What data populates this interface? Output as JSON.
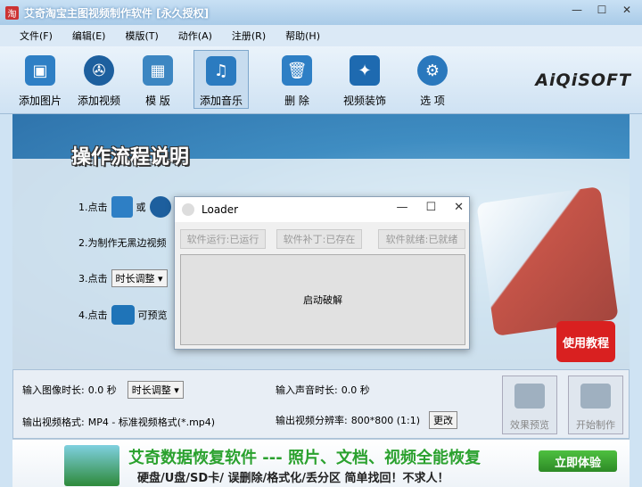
{
  "window": {
    "title": "艾奇淘宝主图视频制作软件 [永久授权]",
    "app_icon": "淘",
    "min": "—",
    "max": "☐",
    "close": "✕"
  },
  "menu": [
    "文件(F)",
    "编辑(E)",
    "模版(T)",
    "动作(A)",
    "注册(R)",
    "帮助(H)"
  ],
  "toolbar": [
    {
      "label": "添加图片",
      "icon": "add-image-icon"
    },
    {
      "label": "添加视频",
      "icon": "add-video-icon"
    },
    {
      "label": "模 版",
      "icon": "template-icon"
    },
    {
      "label": "添加音乐",
      "icon": "music-note-icon",
      "active": true
    },
    {
      "label": "删 除",
      "icon": "trash-icon"
    },
    {
      "label": "视频装饰",
      "icon": "decoration-icon"
    },
    {
      "label": "选 项",
      "icon": "gear-icon"
    }
  ],
  "brand": "AiQiSOFT",
  "main": {
    "heading": "操作流程说明",
    "step1_prefix": "1.点击",
    "step1_or": "或",
    "step2": "2.为制作无黑边视频",
    "step3_prefix": "3.点击",
    "step3_btn": "时长调整 ▾",
    "step4_prefix": "4.点击",
    "step4_text": "可预览",
    "tutorial": "使用教程"
  },
  "settings": {
    "image_duration_label": "输入图像时长:",
    "image_duration_value": "0.0 秒",
    "duration_adjust": "时长调整 ▾",
    "audio_duration_label": "输入声音时长:",
    "audio_duration_value": "0.0 秒",
    "output_format_label": "输出视频格式:",
    "output_format_value": "MP4 - 标准视频格式(*.mp4)",
    "resolution_label": "输出视频分辨率:",
    "resolution_value": "800*800 (1:1)",
    "change": "更改",
    "preview": "效果预览",
    "start": "开始制作"
  },
  "ad": {
    "title": "艾奇数据恢复软件 --- 照片、文档、视频全能恢复",
    "subtitle": "硬盘/U盘/SD卡/ 误删除/格式化/丢分区   简单找回！不求人！",
    "cta": "立即体验"
  },
  "loader": {
    "title": "Loader",
    "status_running": "软件运行:已运行",
    "status_patch": "软件补丁:已存在",
    "status_ready": "软件就绪:已就绪",
    "crack_button": "启动破解",
    "min": "—",
    "max": "☐",
    "close": "✕"
  }
}
